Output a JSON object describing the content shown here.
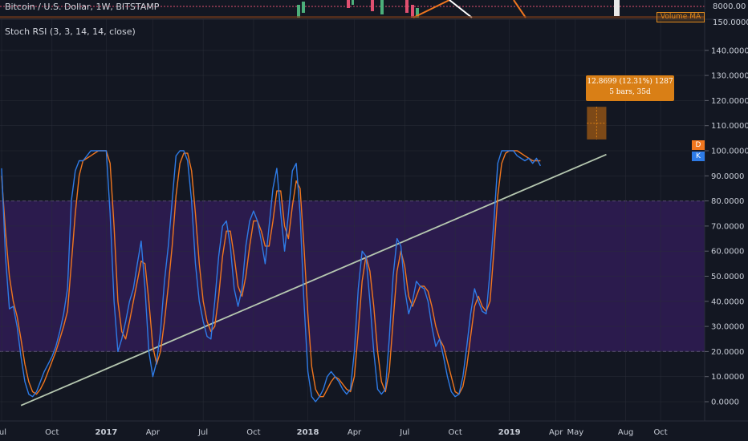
{
  "header": {
    "main_title": "Bitcoin / U.S. Dollar, 1W, BITSTAMP",
    "indicator": "Stoch RSI (3, 3, 14, 14, close)",
    "volume_tag": "Volume MA",
    "price_axis_top": "8000.00",
    "price_axis_top2": "150.0000"
  },
  "measure_tool": {
    "line1": "12.8699 (12.31%) 1287",
    "line2": "5 bars, 35d"
  },
  "badges": {
    "d": "D",
    "k": "K"
  },
  "colors": {
    "background": "#131722",
    "band_fill": "#2b1b4d",
    "k_line": "#2e7be6",
    "d_line": "#f0761f",
    "trendline": "#b5c7b0",
    "measure": "#d97f16",
    "badge_d": "#f0761f",
    "badge_k": "#2e7be6"
  },
  "chart_data": {
    "type": "line",
    "title": "Stoch RSI (3, 3, 14, 14, close)",
    "ylim": [
      -7,
      145
    ],
    "y_ticks": [
      "0.0000",
      "10.0000",
      "20.0000",
      "30.0000",
      "40.0000",
      "50.0000",
      "60.0000",
      "70.0000",
      "80.0000",
      "90.0000",
      "100.0000",
      "110.0000",
      "120.0000",
      "130.0000",
      "140.0000"
    ],
    "y_tick_values": [
      0,
      10,
      20,
      30,
      40,
      50,
      60,
      70,
      80,
      90,
      100,
      110,
      120,
      130,
      140
    ],
    "band": [
      20,
      80
    ],
    "x_ticks": [
      {
        "label": "Jul",
        "i": 0,
        "year": false
      },
      {
        "label": "Oct",
        "i": 13,
        "year": false
      },
      {
        "label": "2017",
        "i": 27,
        "year": true
      },
      {
        "label": "Apr",
        "i": 39,
        "year": false
      },
      {
        "label": "Jul",
        "i": 52,
        "year": false
      },
      {
        "label": "Oct",
        "i": 65,
        "year": false
      },
      {
        "label": "2018",
        "i": 79,
        "year": true
      },
      {
        "label": "Apr",
        "i": 91,
        "year": false
      },
      {
        "label": "Jul",
        "i": 104,
        "year": false
      },
      {
        "label": "Oct",
        "i": 117,
        "year": false
      },
      {
        "label": "2019",
        "i": 131,
        "year": true
      },
      {
        "label": "Apr",
        "i": 143,
        "year": false
      },
      {
        "label": "May",
        "i": 148,
        "year": false
      },
      {
        "label": "Aug",
        "i": 161,
        "year": false
      },
      {
        "label": "Oct",
        "i": 170,
        "year": false
      }
    ],
    "series": [
      {
        "name": "K",
        "values": [
          93,
          58,
          37,
          38,
          30,
          18,
          8,
          3,
          2,
          4,
          8,
          12,
          15,
          18,
          22,
          28,
          35,
          45,
          80,
          92,
          96,
          96,
          98,
          100,
          100,
          100,
          100,
          100,
          75,
          40,
          20,
          25,
          32,
          40,
          45,
          55,
          64,
          45,
          20,
          10,
          16,
          28,
          48,
          62,
          80,
          98,
          100,
          100,
          96,
          80,
          55,
          40,
          32,
          26,
          25,
          40,
          58,
          70,
          72,
          62,
          45,
          38,
          45,
          62,
          72,
          76,
          72,
          64,
          55,
          70,
          85,
          93,
          75,
          60,
          75,
          92,
          95,
          75,
          40,
          12,
          2,
          0,
          2,
          5,
          10,
          12,
          10,
          8,
          5,
          3,
          5,
          20,
          45,
          60,
          58,
          40,
          20,
          5,
          3,
          5,
          25,
          50,
          65,
          62,
          45,
          35,
          40,
          48,
          46,
          45,
          40,
          30,
          22,
          25,
          18,
          10,
          4,
          2,
          3,
          10,
          22,
          35,
          45,
          40,
          36,
          35,
          52,
          72,
          95,
          100,
          100,
          100,
          100,
          98,
          97,
          96,
          97,
          95,
          97,
          94
        ]
      },
      {
        "name": "D",
        "values": [
          90,
          68,
          50,
          40,
          34,
          25,
          15,
          8,
          4,
          3,
          5,
          8,
          12,
          16,
          20,
          25,
          30,
          36,
          55,
          75,
          90,
          96,
          97,
          98,
          99,
          100,
          100,
          100,
          95,
          70,
          40,
          28,
          25,
          32,
          40,
          48,
          56,
          55,
          40,
          22,
          15,
          20,
          32,
          46,
          62,
          82,
          95,
          99,
          99,
          92,
          75,
          55,
          40,
          32,
          28,
          30,
          42,
          58,
          68,
          68,
          58,
          46,
          42,
          50,
          62,
          72,
          72,
          68,
          62,
          62,
          72,
          84,
          84,
          70,
          65,
          78,
          88,
          85,
          62,
          35,
          14,
          5,
          2,
          2,
          5,
          8,
          10,
          9,
          7,
          5,
          4,
          10,
          28,
          48,
          58,
          52,
          38,
          20,
          8,
          4,
          12,
          32,
          52,
          60,
          54,
          42,
          38,
          42,
          46,
          46,
          44,
          38,
          30,
          25,
          22,
          16,
          10,
          4,
          3,
          6,
          14,
          26,
          38,
          42,
          38,
          36,
          40,
          60,
          82,
          95,
          99,
          100,
          100,
          100,
          99,
          98,
          97,
          96,
          96,
          96
        ]
      }
    ],
    "trendline": {
      "from": {
        "i": 5,
        "v": -1.5
      },
      "to": {
        "i": 156,
        "v": 98.5
      }
    },
    "measure_box": {
      "i0": 151,
      "i1": 156,
      "v0": 104.5,
      "v1": 117.5
    }
  }
}
